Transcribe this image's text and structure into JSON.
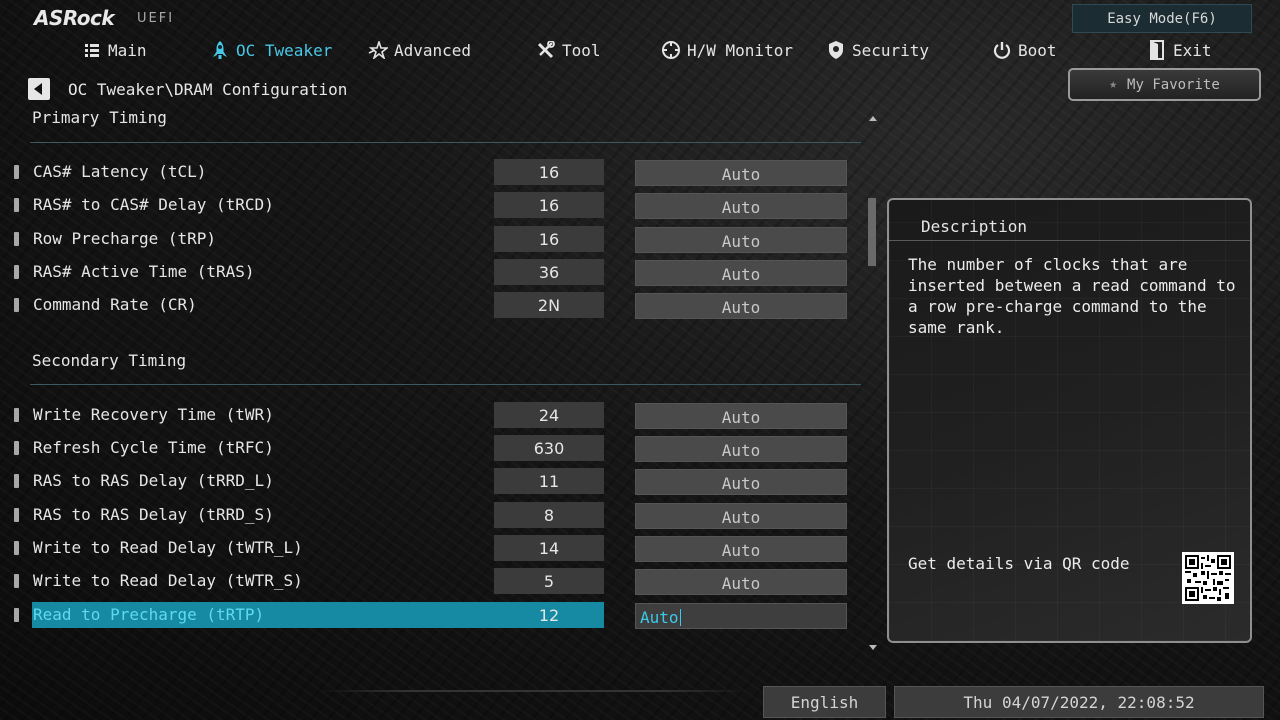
{
  "brand": {
    "logo": "ASRock",
    "sub": "UEFI"
  },
  "easy_mode_label": "Easy Mode(F6)",
  "nav": [
    {
      "label": "Main",
      "icon": "list-icon",
      "active": false
    },
    {
      "label": "OC Tweaker",
      "icon": "rocket-icon",
      "active": true
    },
    {
      "label": "Advanced",
      "icon": "star-icon",
      "active": false
    },
    {
      "label": "Tool",
      "icon": "tools-icon",
      "active": false
    },
    {
      "label": "H/W Monitor",
      "icon": "monitor-icon",
      "active": false
    },
    {
      "label": "Security",
      "icon": "shield-icon",
      "active": false
    },
    {
      "label": "Boot",
      "icon": "power-icon",
      "active": false
    },
    {
      "label": "Exit",
      "icon": "exit-icon",
      "active": false
    }
  ],
  "breadcrumb": "OC Tweaker\\DRAM Configuration",
  "favorite_label": "My Favorite",
  "sections": {
    "primary": {
      "title": "Primary Timing",
      "rows": [
        {
          "label": "CAS# Latency (tCL)",
          "value": "16",
          "setting": "Auto"
        },
        {
          "label": "RAS# to CAS# Delay (tRCD)",
          "value": "16",
          "setting": "Auto"
        },
        {
          "label": "Row Precharge (tRP)",
          "value": "16",
          "setting": "Auto"
        },
        {
          "label": "RAS# Active Time (tRAS)",
          "value": "36",
          "setting": "Auto"
        },
        {
          "label": "Command Rate (CR)",
          "value": "2N",
          "setting": "Auto"
        }
      ]
    },
    "secondary": {
      "title": "Secondary Timing",
      "rows": [
        {
          "label": "Write Recovery Time (tWR)",
          "value": "24",
          "setting": "Auto"
        },
        {
          "label": "Refresh Cycle Time (tRFC)",
          "value": "630",
          "setting": "Auto"
        },
        {
          "label": "RAS to RAS Delay (tRRD_L)",
          "value": "11",
          "setting": "Auto"
        },
        {
          "label": "RAS to RAS Delay (tRRD_S)",
          "value": "8",
          "setting": "Auto"
        },
        {
          "label": "Write to Read Delay (tWTR_L)",
          "value": "14",
          "setting": "Auto"
        },
        {
          "label": "Write to Read Delay (tWTR_S)",
          "value": "5",
          "setting": "Auto"
        },
        {
          "label": "Read to Precharge (tRTP)",
          "value": "12",
          "setting": "Auto",
          "selected": true
        }
      ]
    }
  },
  "description": {
    "title": "Description",
    "text": "The number of clocks that are inserted between a read command to a row pre-charge command to the same rank.",
    "qr_label": "Get details via QR code"
  },
  "footer": {
    "language": "English",
    "datetime": "Thu 04/07/2022, 22:08:52"
  },
  "colors": {
    "accent": "#48c7e6",
    "selection": "#1689a3"
  }
}
